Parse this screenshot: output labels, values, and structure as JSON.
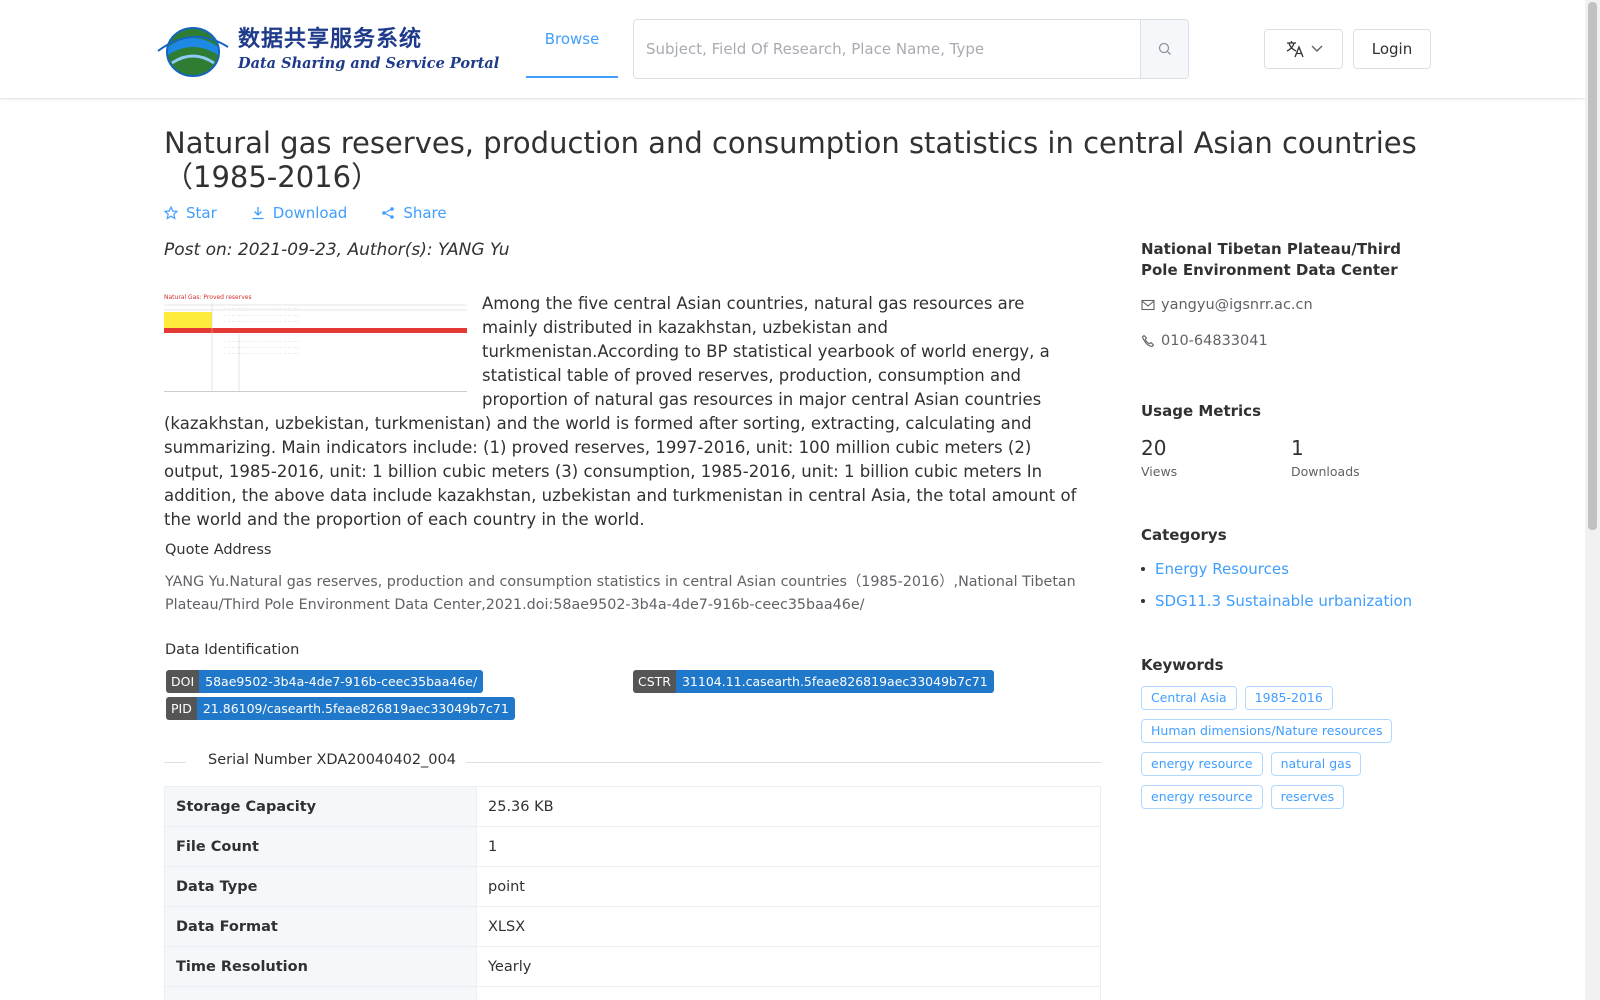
{
  "header": {
    "logo_cn": "数据共享服务系统",
    "logo_en": "Data Sharing and Service Portal",
    "nav_browse": "Browse",
    "search_placeholder": "Subject, Field Of Research, Place Name, Type",
    "login": "Login",
    "icons": {
      "search": "search-icon",
      "language": "translate-icon",
      "dropdown": "chevron-down-icon"
    }
  },
  "dataset": {
    "title": "Natural gas reserves, production and consumption statistics in central Asian countries（1985-2016）",
    "actions": {
      "star": "Star",
      "download": "Download",
      "share": "Share"
    },
    "post_on": "Post on: 2021-09-23, Author(s): YANG Yu",
    "abstract": "Among the five central Asian countries, natural gas resources are mainly distributed in kazakhstan, uzbekistan and turkmenistan.According to BP statistical yearbook of world energy, a statistical table of proved reserves, production, consumption and proportion of natural gas resources in major central Asian countries (kazakhstan, uzbekistan, turkmenistan) and the world is formed after sorting, extracting, calculating and summarizing. Main indicators include: (1) proved reserves, 1997-2016, unit: 100 million cubic meters (2) output, 1985-2016, unit: 1 billion cubic meters (3) consumption, 1985-2016, unit: 1 billion cubic meters In addition, the above data include kazakhstan, uzbekistan and turkmenistan in central Asia, the total amount of the world and the proportion of each country in the world.",
    "thumbnail_caption": "Natural Gas: Proved reserves",
    "quote_label": "Quote Address",
    "quote_text": "YANG Yu.Natural gas reserves, production and consumption statistics in central Asian countries（1985-2016）,National Tibetan Plateau/Third Pole Environment Data Center,2021.doi:58ae9502-3b4a-4de7-916b-ceec35baa46e/",
    "identification_label": "Data Identification",
    "identifiers": {
      "doi_key": "DOI",
      "doi_val": "58ae9502-3b4a-4de7-916b-ceec35baa46e/",
      "cstr_key": "CSTR",
      "cstr_val": "31104.11.casearth.5feae826819aec33049b7c71",
      "pid_key": "PID",
      "pid_val": "21.86109/casearth.5feae826819aec33049b7c71"
    },
    "serial_number": "Serial Number XDA20040402_004",
    "info_rows": [
      {
        "key": "Storage Capacity",
        "value": "25.36 KB"
      },
      {
        "key": "File Count",
        "value": "1"
      },
      {
        "key": "Data Type",
        "value": "point"
      },
      {
        "key": "Data Format",
        "value": "XLSX"
      },
      {
        "key": "Time Resolution",
        "value": "Yearly"
      }
    ]
  },
  "sidebar": {
    "center_name": "National Tibetan Plateau/Third Pole Environment Data Center",
    "email": "yangyu@igsnrr.ac.cn",
    "phone": "010-64833041",
    "usage_title": "Usage Metrics",
    "views": "20",
    "views_label": "Views",
    "downloads": "1",
    "downloads_label": "Downloads",
    "categories_title": "Categorys",
    "categories": [
      "Energy Resources",
      "SDG11.3 Sustainable urbanization"
    ],
    "keywords_title": "Keywords",
    "keywords": [
      "Central Asia",
      "1985-2016",
      "Human dimensions/Nature resources",
      "energy resource",
      "natural gas",
      "energy resource",
      "reserves"
    ]
  },
  "colors": {
    "accent": "#409eff",
    "tag_dark": "#555555",
    "tag_blue": "#1f78c9",
    "border": "#dcdfe6"
  }
}
